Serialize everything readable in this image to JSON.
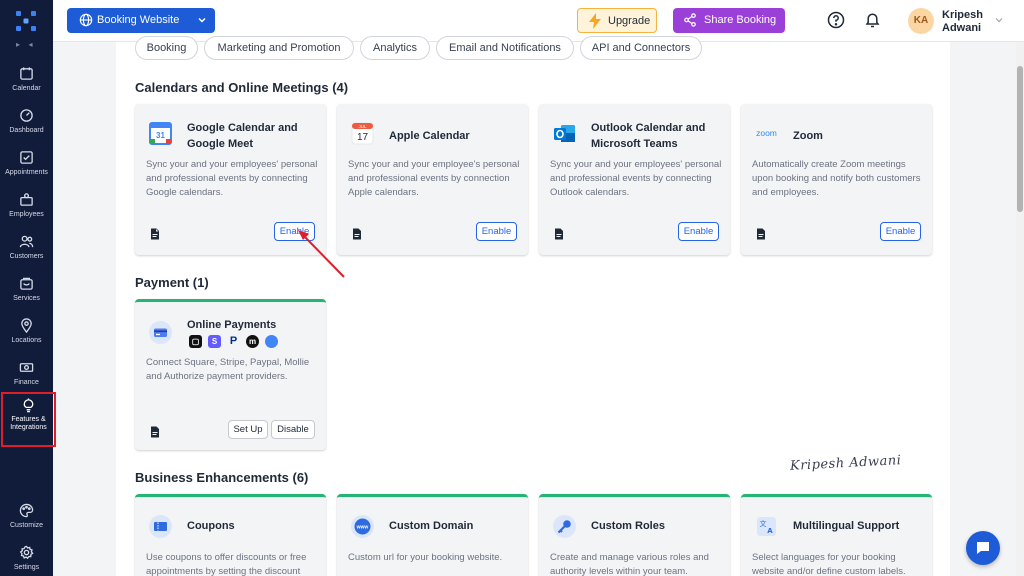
{
  "sidebar": {
    "collapse_glyph": "▸ ◂",
    "items": [
      {
        "label": "Calendar",
        "icon": "calendar-icon"
      },
      {
        "label": "Dashboard",
        "icon": "dashboard-icon"
      },
      {
        "label": "Appointments",
        "icon": "appointments-icon"
      },
      {
        "label": "Employees",
        "icon": "employees-icon"
      },
      {
        "label": "Customers",
        "icon": "customers-icon"
      },
      {
        "label": "Services",
        "icon": "services-icon"
      },
      {
        "label": "Locations",
        "icon": "location-pin-icon"
      },
      {
        "label": "Finance",
        "icon": "finance-icon"
      },
      {
        "label": "Features &",
        "label2": "Integrations",
        "icon": "lightbulb-icon",
        "active": true
      },
      {
        "label": "Customize",
        "icon": "palette-icon"
      },
      {
        "label": "Settings",
        "icon": "gear-icon"
      }
    ]
  },
  "topbar": {
    "website_select": "Booking Website",
    "upgrade": "Upgrade",
    "share": "Share Booking",
    "user_initials": "KA",
    "user_first": "Kripesh",
    "user_last": "Adwani"
  },
  "chips": [
    "Booking",
    "Marketing and Promotion",
    "Analytics",
    "Email and Notifications",
    "API and Connectors"
  ],
  "sections": {
    "calendars": {
      "title": "Calendars and Online Meetings (4)",
      "cards": [
        {
          "title": "Google Calendar and Google Meet",
          "desc": "Sync your and your employees' personal and professional events by connecting Google calendars.",
          "button": "Enable",
          "icon": "google-calendar-icon",
          "icon_text": "31"
        },
        {
          "title": "Apple Calendar",
          "desc": "Sync your and your employee's personal and professional events by connection Apple calendars.",
          "button": "Enable",
          "icon": "apple-calendar-icon",
          "icon_month": "JUL",
          "icon_text": "17"
        },
        {
          "title": "Outlook Calendar and Microsoft Teams",
          "desc": "Sync your and your employees' personal and professional events by connecting Outlook calendars.",
          "button": "Enable",
          "icon": "outlook-icon"
        },
        {
          "title": "Zoom",
          "desc": "Automatically create Zoom meetings upon booking and notify both customers and employees.",
          "button": "Enable",
          "icon": "zoom-icon",
          "icon_text": "zoom"
        }
      ]
    },
    "payment": {
      "title": "Payment (1)",
      "card": {
        "title": "Online Payments",
        "desc": "Connect Square, Stripe, Paypal, Mollie and Authorize payment providers.",
        "setup": "Set Up",
        "disable": "Disable",
        "icon": "credit-card-icon"
      }
    },
    "business": {
      "title": "Business Enhancements (6)",
      "cards": [
        {
          "title": "Coupons",
          "desc": "Use coupons to offer discounts or free appointments by setting the discount",
          "icon": "coupon-icon"
        },
        {
          "title": "Custom Domain",
          "desc": "Custom url for your booking website.",
          "icon": "www-icon",
          "icon_text": "www"
        },
        {
          "title": "Custom Roles",
          "desc": "Create and manage various roles and authority levels within your team.",
          "icon": "key-icon"
        },
        {
          "title": "Multilingual Support",
          "desc": "Select languages for your booking website and/or define custom labels.",
          "icon": "translate-icon"
        }
      ]
    }
  },
  "signature": "Kripesh Adwani",
  "colors": {
    "sidebar": "#111b3a",
    "primary": "#1d5cd6",
    "share": "#9b3fd9",
    "upgrade_bg": "#fff4d9",
    "active_outline": "#e11d2a",
    "green_accent": "#22b573"
  }
}
